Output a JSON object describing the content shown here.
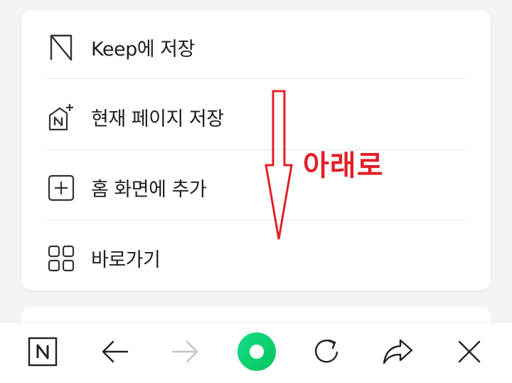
{
  "menu": {
    "items": [
      {
        "label": "Keep에 저장",
        "icon": "bookmark-icon"
      },
      {
        "label": "현재 페이지 저장",
        "icon": "naver-house-plus-icon"
      },
      {
        "label": "홈 화면에 추가",
        "icon": "plus-square-icon"
      },
      {
        "label": "바로가기",
        "icon": "grid-icon"
      }
    ]
  },
  "toolbar": {
    "icons": [
      "naver-n-icon",
      "back-arrow-icon",
      "forward-arrow-icon",
      "green-ring-home-icon",
      "refresh-icon",
      "share-arrow-icon",
      "close-icon"
    ],
    "naver_letter": "N",
    "green": "#10d078",
    "disabled_color": "#c4c4c4"
  },
  "annotation": {
    "text": "아래로",
    "color": "#e02028"
  }
}
